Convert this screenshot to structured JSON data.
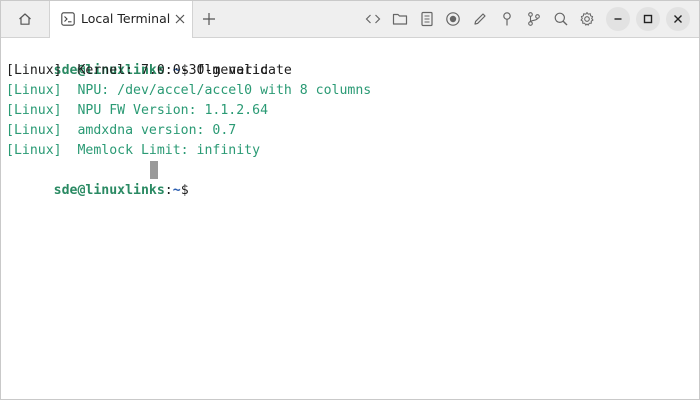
{
  "tabs": [
    {
      "label": "Local Terminal",
      "icon": "terminal-icon",
      "active": true
    }
  ],
  "toolbar_icons": [
    "code-icon",
    "folder-icon",
    "document-icon",
    "record-icon",
    "pencil-icon",
    "pin-icon",
    "git-branch-icon",
    "search-icon",
    "gear-icon"
  ],
  "window_controls": [
    "minimize-icon",
    "maximize-icon",
    "close-icon"
  ],
  "terminal": {
    "prompt": {
      "user_host": "sde@linuxlinks",
      "colon": ":",
      "path": "~",
      "dollar": "$"
    },
    "command": " flm validate",
    "output": [
      {
        "text": "[Linux]  Kernel: 7.0.0-30-generic",
        "style": "plain"
      },
      {
        "text": "[Linux]  NPU: /dev/accel/accel0 with 8 columns",
        "style": "info"
      },
      {
        "text": "[Linux]  NPU FW Version: 1.1.2.64",
        "style": "info"
      },
      {
        "text": "[Linux]  amdxdna version: 0.7",
        "style": "info"
      },
      {
        "text": "[Linux]  Memlock Limit: infinity",
        "style": "info"
      }
    ]
  },
  "colors": {
    "prompt_user": "#2a8a63",
    "prompt_path": "#2a5db0",
    "info_text": "#2a9a74",
    "plain_text": "#1e1e1e",
    "cursor": "#9a9a9a",
    "tabbar_bg": "#efefef"
  }
}
